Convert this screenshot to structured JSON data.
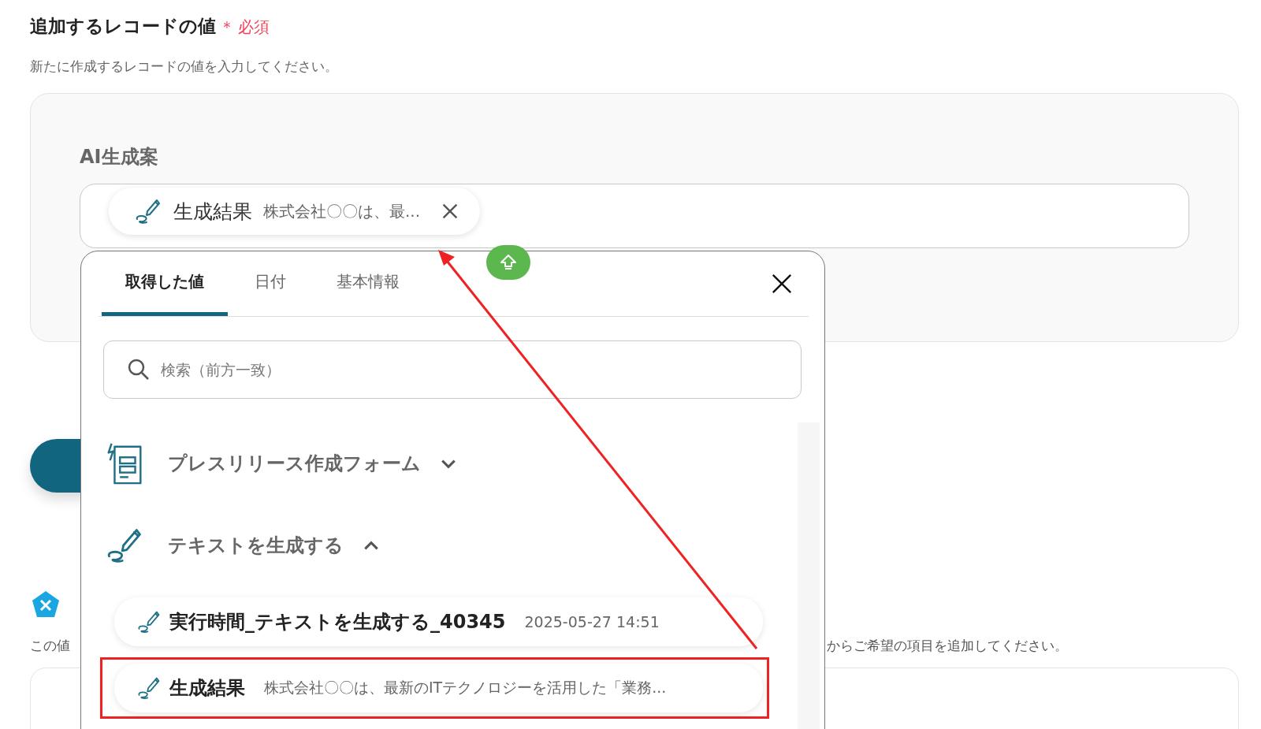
{
  "header": {
    "title": "追加するレコードの値",
    "required_mark": "＊",
    "required_label": "必須",
    "description": "新たに作成するレコードの値を入力してください。"
  },
  "field": {
    "label": "AI生成案",
    "chip": {
      "name": "生成結果",
      "preview": "株式会社〇〇は、最..."
    }
  },
  "below": {
    "description_start": "この値",
    "description_end": "からご希望の項目を追加してください。"
  },
  "popup": {
    "tabs": [
      {
        "label": "取得した値",
        "selected": true
      },
      {
        "label": "日付",
        "selected": false
      },
      {
        "label": "基本情報",
        "selected": false
      }
    ],
    "search": {
      "placeholder": "検索（前方一致）"
    },
    "groups": [
      {
        "label": "プレスリリース作成フォーム",
        "kind": "form",
        "expanded": false
      },
      {
        "label": "テキストを生成する",
        "kind": "pencil",
        "expanded": true,
        "children": [
          {
            "name": "実行時間_テキストを生成する_40345",
            "value": "2025-05-27 14:51",
            "highlighted": false
          },
          {
            "name": "生成結果",
            "value": "株式会社〇〇は、最新のITテクノロジーを活用した「業務...",
            "highlighted": true
          }
        ]
      }
    ]
  }
}
